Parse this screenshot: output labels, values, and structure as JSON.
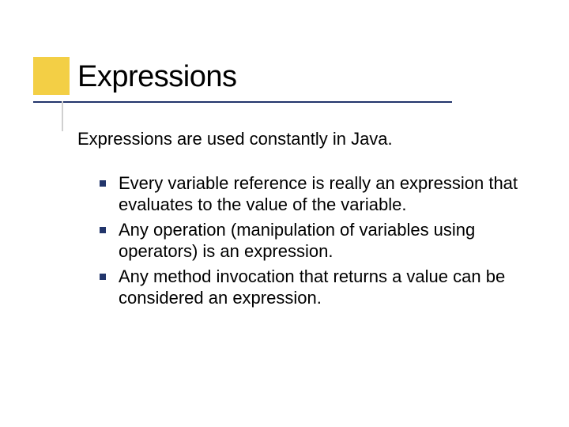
{
  "title": "Expressions",
  "intro": "Expressions are used constantly in Java.",
  "bullets": [
    "Every variable reference is really an expression that evaluates to the value of the variable.",
    "Any operation (manipulation of variables using operators) is an expression.",
    "Any method invocation that returns a value can be considered an expression."
  ]
}
